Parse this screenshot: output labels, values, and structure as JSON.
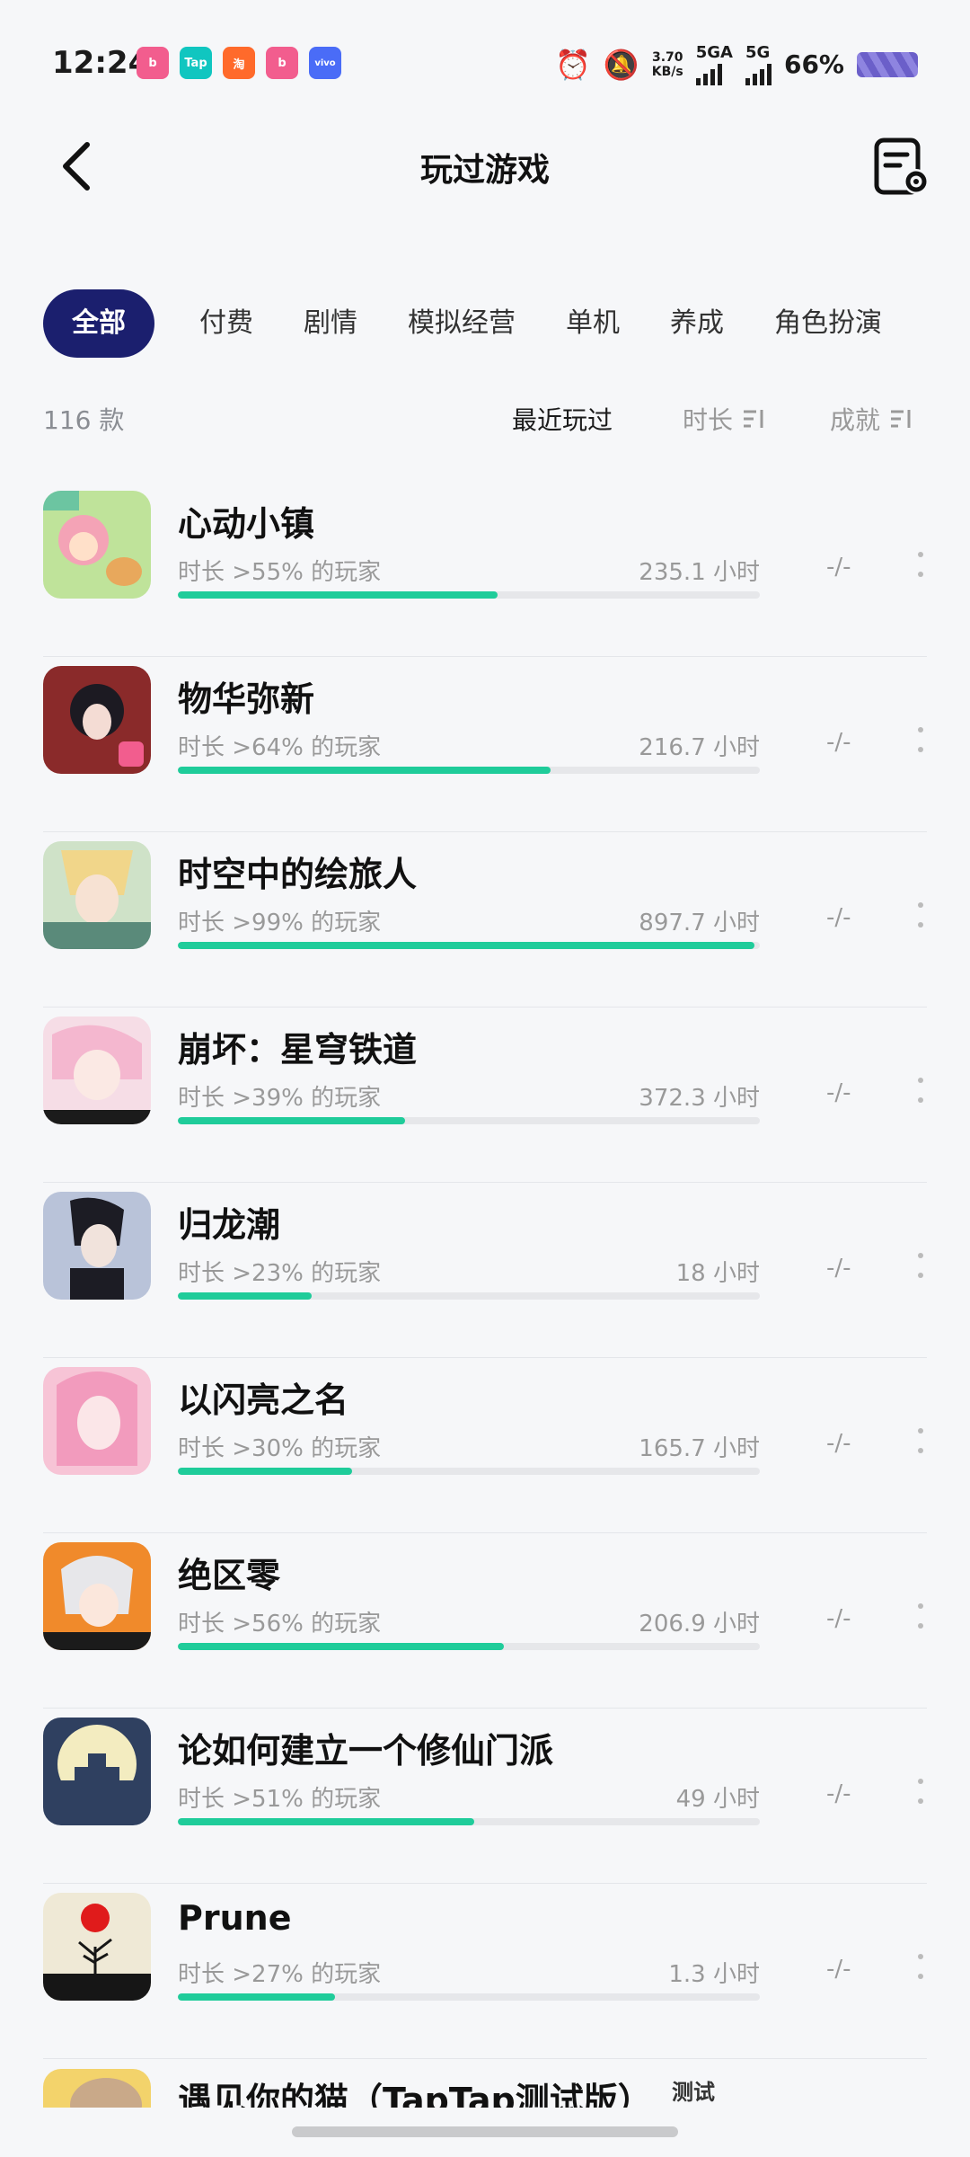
{
  "status_bar": {
    "time": "12:24",
    "notifications": [
      "bilibili",
      "Tap",
      "淘",
      "bilibili",
      "vivo"
    ],
    "speed_value": "3.70",
    "speed_unit": "KB/s",
    "net1": "5GA",
    "net2": "5G",
    "battery": "66%"
  },
  "header": {
    "title": "玩过游戏"
  },
  "tabs": [
    "全部",
    "付费",
    "剧情",
    "模拟经营",
    "单机",
    "养成",
    "角色扮演"
  ],
  "sort": {
    "count": "116 款",
    "recent": "最近玩过",
    "time": "时长",
    "achievement": "成就"
  },
  "games": [
    {
      "name": "心动小镇",
      "sub": "时长 >55% 的玩家",
      "hours": "235.1 小时",
      "ach": "-/-",
      "progress": 55
    },
    {
      "name": "物华弥新",
      "sub": "时长 >64% 的玩家",
      "hours": "216.7 小时",
      "ach": "-/-",
      "progress": 64
    },
    {
      "name": "时空中的绘旅人",
      "sub": "时长 >99% 的玩家",
      "hours": "897.7 小时",
      "ach": "-/-",
      "progress": 99
    },
    {
      "name": "崩坏：星穹铁道",
      "sub": "时长 >39% 的玩家",
      "hours": "372.3 小时",
      "ach": "-/-",
      "progress": 39
    },
    {
      "name": "归龙潮",
      "sub": "时长 >23% 的玩家",
      "hours": "18 小时",
      "ach": "-/-",
      "progress": 23
    },
    {
      "name": "以闪亮之名",
      "sub": "时长 >30% 的玩家",
      "hours": "165.7 小时",
      "ach": "-/-",
      "progress": 30
    },
    {
      "name": "绝区零",
      "sub": "时长 >56% 的玩家",
      "hours": "206.9 小时",
      "ach": "-/-",
      "progress": 56
    },
    {
      "name": "论如何建立一个修仙门派",
      "sub": "时长 >51% 的玩家",
      "hours": "49 小时",
      "ach": "-/-",
      "progress": 51
    },
    {
      "name": "Prune",
      "sub": "时长 >27% 的玩家",
      "hours": "1.3 小时",
      "ach": "-/-",
      "progress": 27
    }
  ],
  "last_game": {
    "name": "遇见你的猫（TapTap测试版）",
    "badge": "测试"
  },
  "colors": {
    "accent": "#1fcc9a",
    "tab_active": "#1b1f6e"
  }
}
